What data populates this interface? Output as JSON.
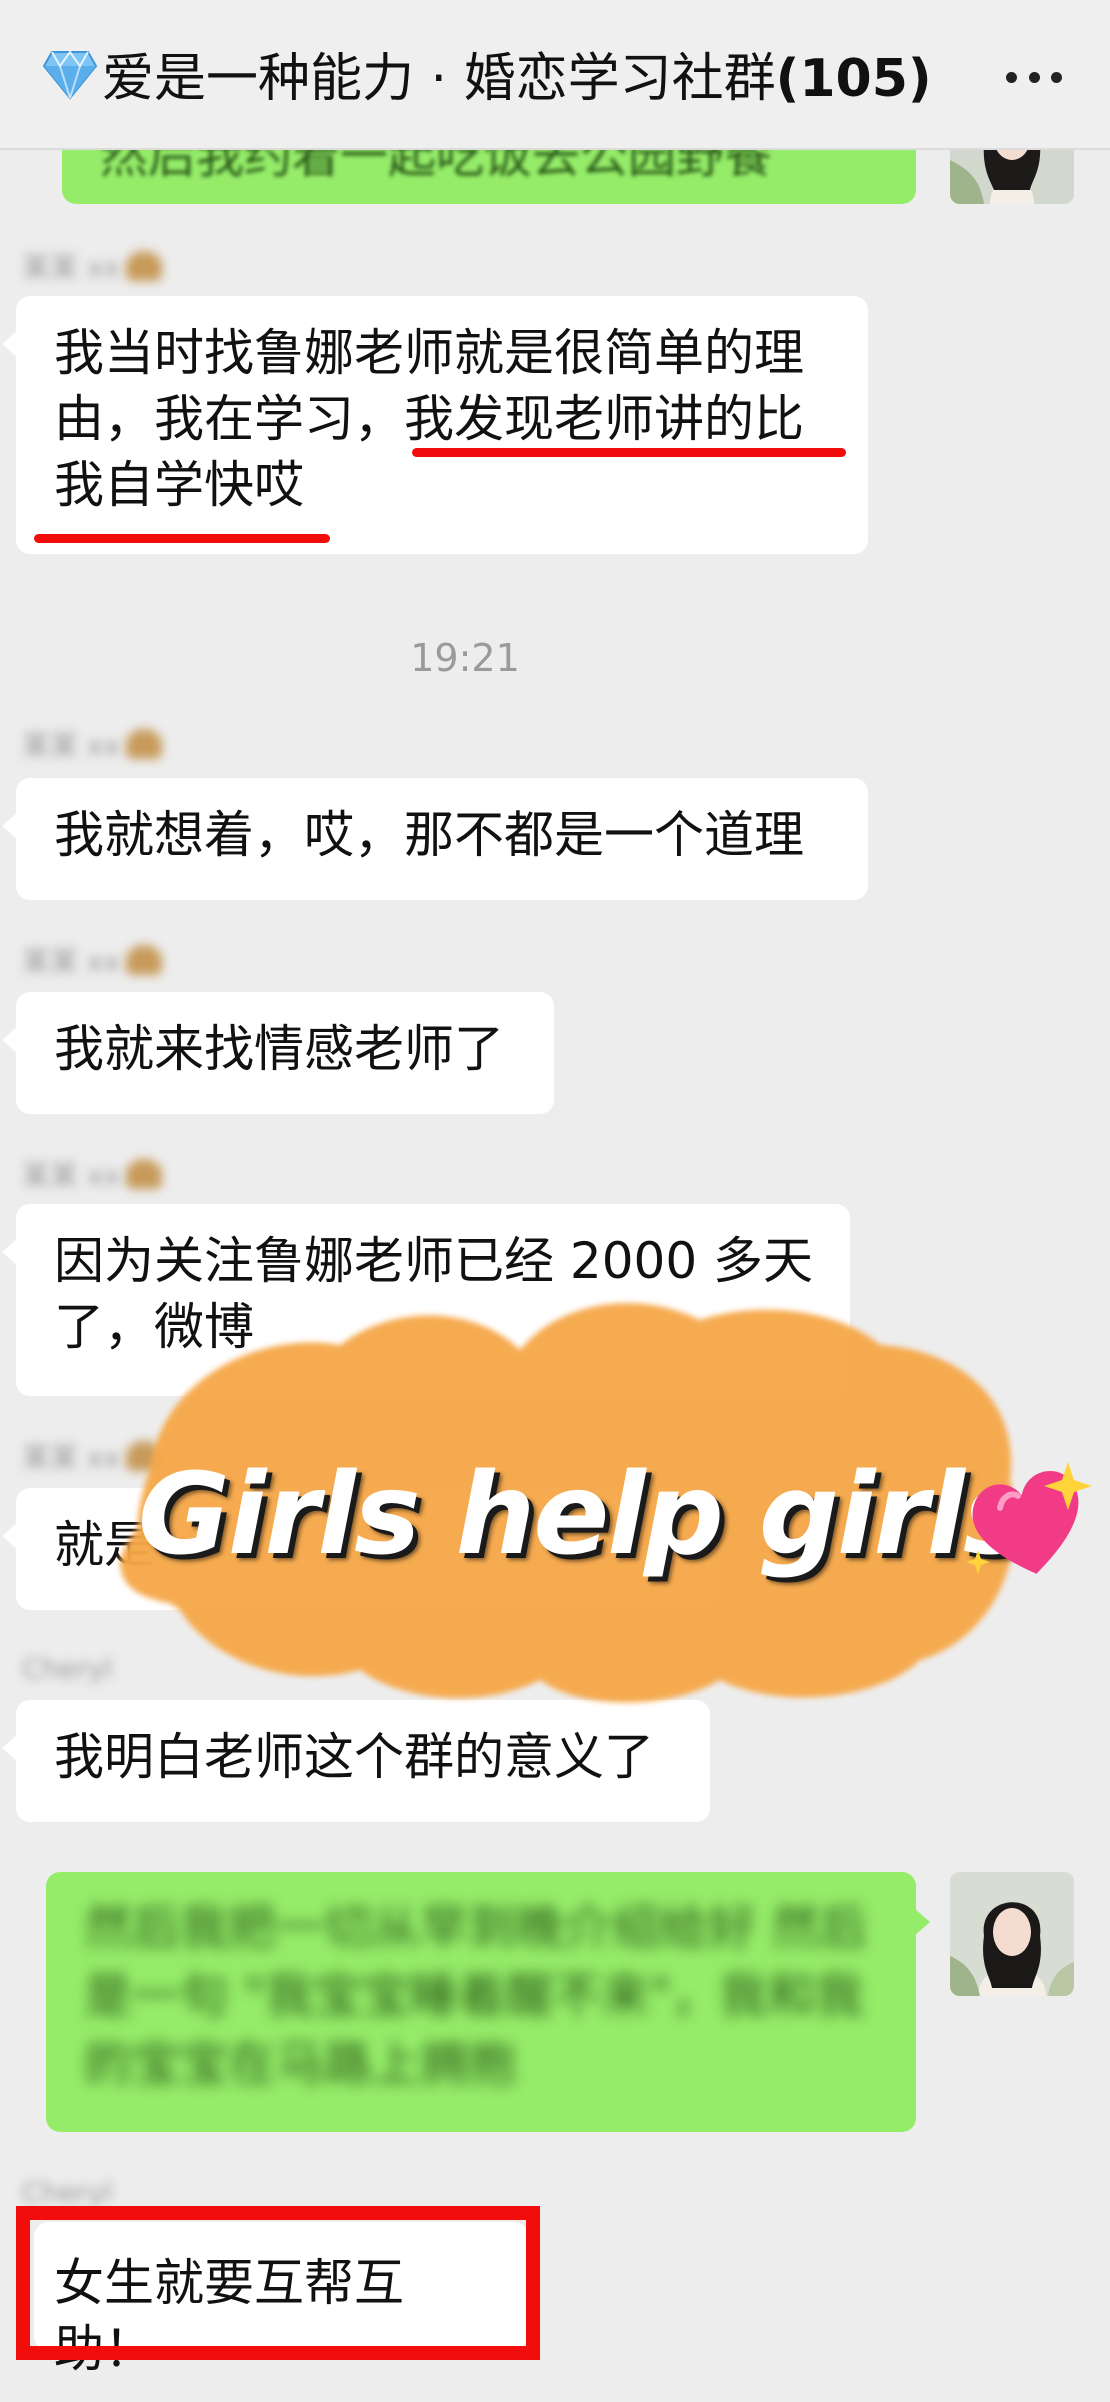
{
  "header": {
    "title": "爱是一种能力 · 婚恋学习社群",
    "member_count": "(105)",
    "more_icon": "more-dots-icon"
  },
  "messages": {
    "m0_text": "然后我约着一起吃饭去公园野餐",
    "m1_sender": "某某 xx",
    "m1_text": "我当时找鲁娜老师就是很简单的理由，我在学习，我发现老师讲的比我自学快哎",
    "time": "19:21",
    "m2_sender": "某某 xx",
    "m2_text": "我就想着，哎，那不都是一个道理",
    "m3_sender": "某某 xx",
    "m3_text": "我就来找情感老师了",
    "m4_sender": "某某 xx",
    "m4_text": "因为关注鲁娜老师已经 2000 多天了，微博",
    "m5_sender": "某某 xx",
    "m5_text": "就是",
    "m6_sender": "Cheryl",
    "m6_text": "我明白老师这个群的意义了",
    "m7_text": "然后我把一切从早到晚介绍给好 然后是一句 \"我宝宝睡着醒不来\"，我和我的宝宝在马路上拥抱",
    "m8_sender": "Cheryl",
    "m8_text": "女生就要互帮互助！"
  },
  "overlay": {
    "slogan": "Girls help girls",
    "sticker_icon": "sparkling-heart-icon"
  },
  "colors": {
    "green_bubble": "#95ec69",
    "highlight_red": "#f20d0d",
    "brush_orange": "#f6a84a"
  }
}
